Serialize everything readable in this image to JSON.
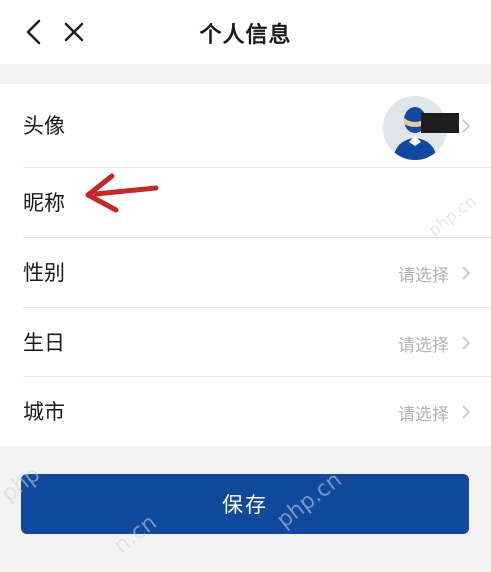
{
  "header": {
    "title": "个人信息",
    "back_icon": "chevron-left-icon",
    "close_icon": "close-icon"
  },
  "rows": [
    {
      "label": "头像",
      "value": ""
    },
    {
      "label": "昵称",
      "value": ""
    },
    {
      "label": "性别",
      "value": "请选择"
    },
    {
      "label": "生日",
      "value": "请选择"
    },
    {
      "label": "城市",
      "value": "请选择"
    }
  ],
  "save_label": "保存",
  "watermarks": [
    "php",
    "php.cn",
    "n.cn",
    "php.cn"
  ],
  "colors": {
    "primary": "#0f4a9c",
    "arrow": "#c62828",
    "placeholder": "#b3b3b3"
  }
}
